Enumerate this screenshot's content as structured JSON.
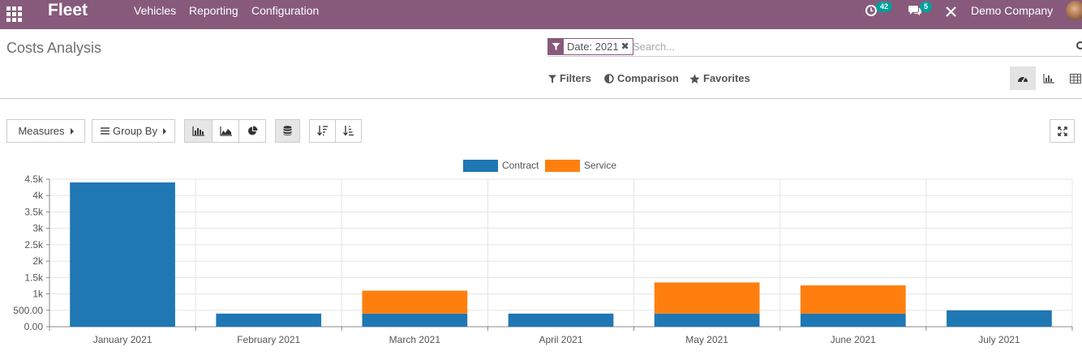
{
  "navbar": {
    "app_name": "Fleet",
    "menus": [
      "Vehicles",
      "Reporting",
      "Configuration"
    ],
    "activity_count": "42",
    "messages_count": "5",
    "company": "Demo Company"
  },
  "control_panel": {
    "title": "Costs Analysis",
    "facet": "Date: 2021",
    "search_placeholder": "Search...",
    "filters_label": "Filters",
    "comparison_label": "Comparison",
    "favorites_label": "Favorites",
    "views": [
      "dashboard-view-icon",
      "graph-view-icon",
      "pivot-view-icon"
    ],
    "active_view": "dashboard-view-icon"
  },
  "graph_toolbar": {
    "measures_label": "Measures",
    "groupby_label": "Group By",
    "active_chart_mode": "bar",
    "stacked": true
  },
  "colors": {
    "navbar": "#875a7b",
    "contract": "#1f77b4",
    "service": "#ff7f0e",
    "badge": "#00a09d"
  },
  "chart_data": {
    "type": "bar",
    "stacked": true,
    "categories": [
      "January 2021",
      "February 2021",
      "March 2021",
      "April 2021",
      "May 2021",
      "June 2021",
      "July 2021"
    ],
    "series": [
      {
        "name": "Contract",
        "color": "#1f77b4",
        "values": [
          4400,
          400,
          400,
          400,
          400,
          400,
          500
        ]
      },
      {
        "name": "Service",
        "color": "#ff7f0e",
        "values": [
          0,
          0,
          700,
          0,
          950,
          860,
          0
        ]
      }
    ],
    "yticks": [
      "0.00",
      "500.00",
      "1k",
      "1.5k",
      "2k",
      "2.5k",
      "3k",
      "3.5k",
      "4k",
      "4.5k"
    ],
    "ylim": [
      0,
      4500
    ],
    "grid": true,
    "legend_position": "top-center"
  }
}
